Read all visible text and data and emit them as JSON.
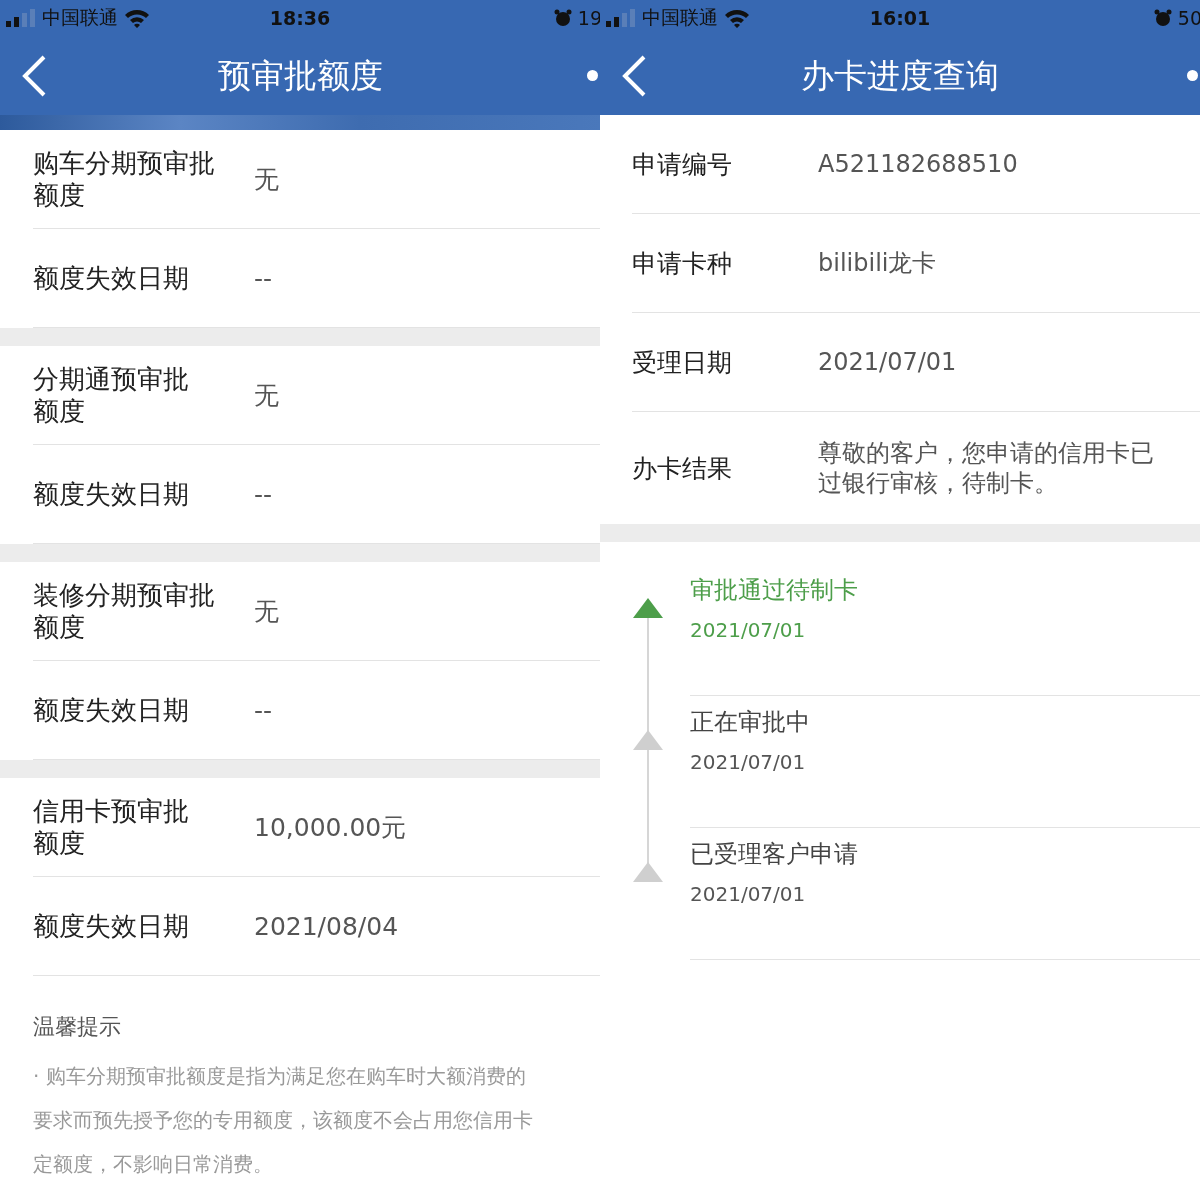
{
  "screens": [
    {
      "status_bar": {
        "carrier": "中国联通",
        "time": "18:36",
        "battery": "19"
      },
      "title": "预审批额度",
      "groups": [
        [
          {
            "label": [
              "购车分期预审批",
              "额度"
            ],
            "value": "无"
          },
          {
            "label": [
              "额度失效日期"
            ],
            "value": "--"
          }
        ],
        [
          {
            "label": [
              "分期通预审批",
              "额度"
            ],
            "value": "无"
          },
          {
            "label": [
              "额度失效日期"
            ],
            "value": "--"
          }
        ],
        [
          {
            "label": [
              "装修分期预审批",
              "额度"
            ],
            "value": "无"
          },
          {
            "label": [
              "额度失效日期"
            ],
            "value": "--"
          }
        ],
        [
          {
            "label": [
              "信用卡预审批",
              "额度"
            ],
            "value": "10,000.00元"
          },
          {
            "label": [
              "额度失效日期"
            ],
            "value": "2021/08/04"
          }
        ]
      ],
      "tips": {
        "title": "温馨提示",
        "lines": [
          "· 购车分期预审批额度是指为满足您在购车时大额消费的",
          "要求而预先授予您的专用额度，该额度不会占用您信用卡",
          "定额度，不影响日常消费。"
        ]
      }
    },
    {
      "status_bar": {
        "carrier": "中国联通",
        "time": "16:01",
        "battery": "50"
      },
      "title": "办卡进度查询",
      "details": [
        {
          "label": "申请编号",
          "lines": [
            "A521182688510"
          ]
        },
        {
          "label": "申请卡种",
          "lines": [
            "bilibili龙卡"
          ]
        },
        {
          "label": "受理日期",
          "lines": [
            "2021/07/01"
          ]
        },
        {
          "label": "办卡结果",
          "lines": [
            "尊敬的客户，您申请的信用卡已",
            "过银行审核，待制卡。"
          ]
        }
      ],
      "timeline": [
        {
          "status": "审批通过待制卡",
          "date": "2021/07/01",
          "current": true
        },
        {
          "status": "正在审批中",
          "date": "2021/07/01",
          "current": false
        },
        {
          "status": "已受理客户申请",
          "date": "2021/07/01",
          "current": false
        }
      ]
    }
  ]
}
